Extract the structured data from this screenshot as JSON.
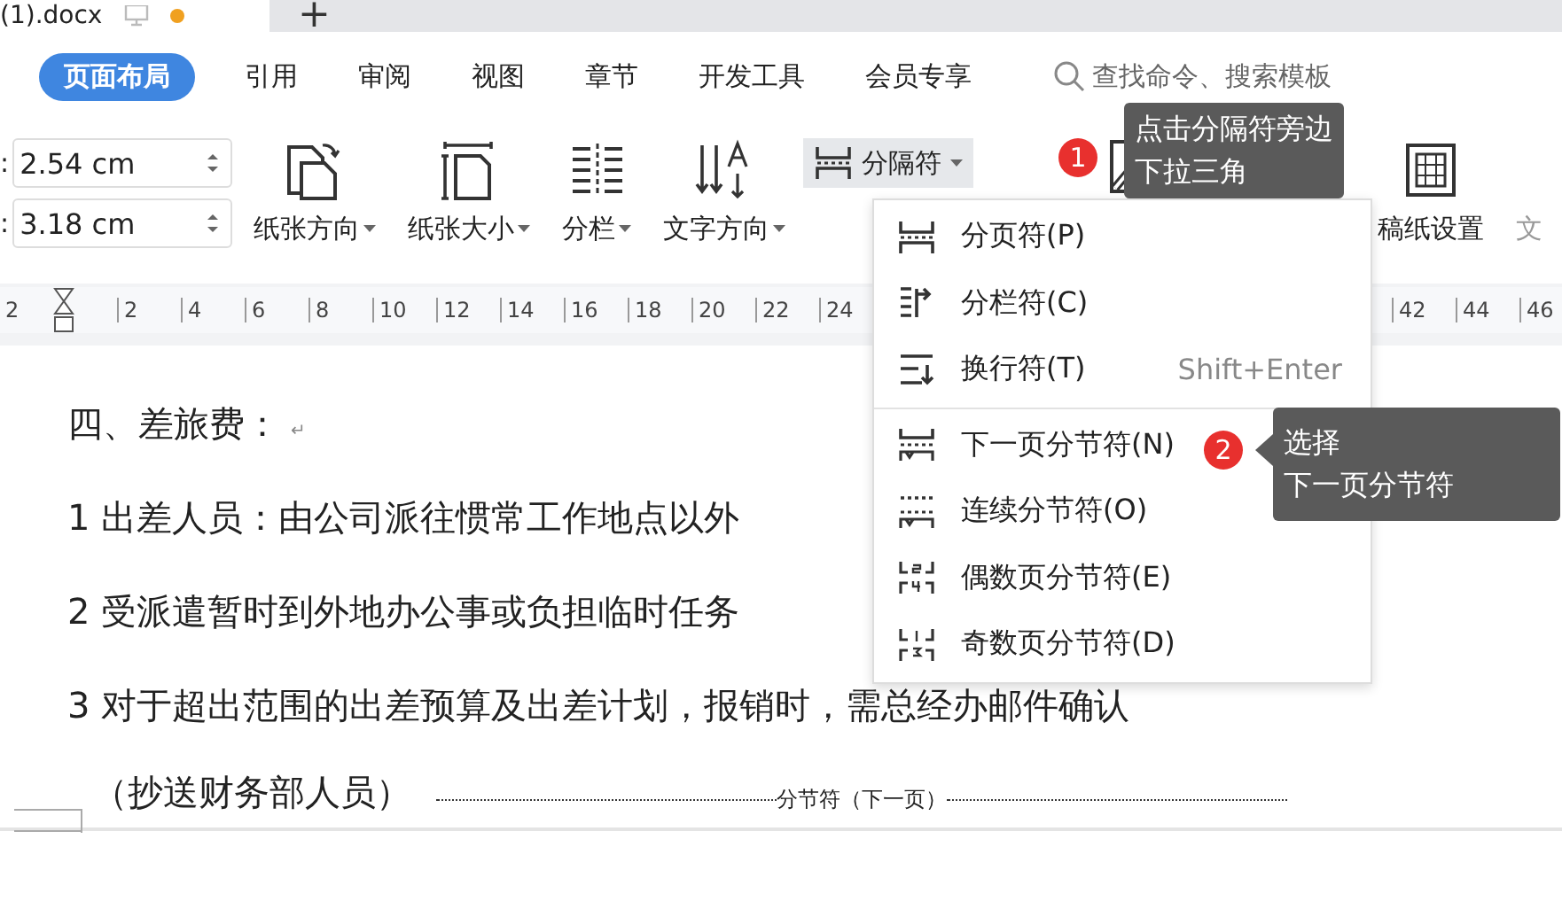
{
  "tab_bar": {
    "document_tab": {
      "title": "(1).docx",
      "unsaved": true
    },
    "new_tab": "+"
  },
  "ribbon_tabs": [
    {
      "label": "页面布局",
      "selected": true
    },
    {
      "label": "引用",
      "selected": false
    },
    {
      "label": "审阅",
      "selected": false
    },
    {
      "label": "视图",
      "selected": false
    },
    {
      "label": "章节",
      "selected": false
    },
    {
      "label": "开发工具",
      "selected": false
    },
    {
      "label": "会员专享",
      "selected": false
    }
  ],
  "search": {
    "placeholder": "查找命令、搜索模板"
  },
  "margins": [
    {
      "label": ":",
      "value": "2.54 cm"
    },
    {
      "label": ":",
      "value": "3.18 cm"
    }
  ],
  "tools": [
    {
      "kind": "large",
      "label": "纸张方向",
      "dropdown": true
    },
    {
      "kind": "large",
      "label": "纸张大小",
      "dropdown": true
    },
    {
      "kind": "large",
      "label": "分栏",
      "dropdown": true
    },
    {
      "kind": "large",
      "label": "文字方向",
      "dropdown": true
    },
    {
      "kind": "small",
      "label": "分隔符",
      "dropdown": true,
      "expanded": true
    },
    {
      "kind": "icon"
    },
    {
      "kind": "large",
      "label": "稿纸设置",
      "dropdown": false
    },
    {
      "kind": "cut",
      "label": "文"
    }
  ],
  "ruler": {
    "left_labels": [
      "2"
    ],
    "labels": [
      "2",
      "4",
      "6",
      "8",
      "10",
      "12",
      "14",
      "16",
      "18",
      "20",
      "22",
      "24"
    ],
    "right_labels": [
      "42",
      "44",
      "46"
    ]
  },
  "document": {
    "paragraphs": [
      {
        "text": "四、差旅费：",
        "para_mark": "↵"
      },
      {
        "text": "1 出差人员：由公司派往惯常工作地点以外"
      },
      {
        "text": "2 受派遣暂时到外地办公事或负担临时任务"
      },
      {
        "text": "3 对于超出范围的出差预算及出差计划，报销时，需总经办邮件确认"
      },
      {
        "text": "（抄送财务部人员）",
        "section_break": "分节符（下一页）"
      }
    ]
  },
  "break_menu": {
    "groups": [
      [
        {
          "label": "分页符(P)"
        },
        {
          "label": "分栏符(C)"
        },
        {
          "label": "换行符(T)",
          "shortcut": "Shift+Enter"
        }
      ],
      [
        {
          "label": "下一页分节符(N)"
        },
        {
          "label": "连续分节符(O)"
        },
        {
          "label": "偶数页分节符(E)"
        },
        {
          "label": "奇数页分节符(D)"
        }
      ]
    ]
  },
  "callouts": [
    {
      "badge": "1",
      "lines": [
        "点击分隔符旁边",
        "下拉三角"
      ]
    },
    {
      "badge": "2",
      "lines": [
        "选择",
        "下一页分节符"
      ]
    }
  ]
}
